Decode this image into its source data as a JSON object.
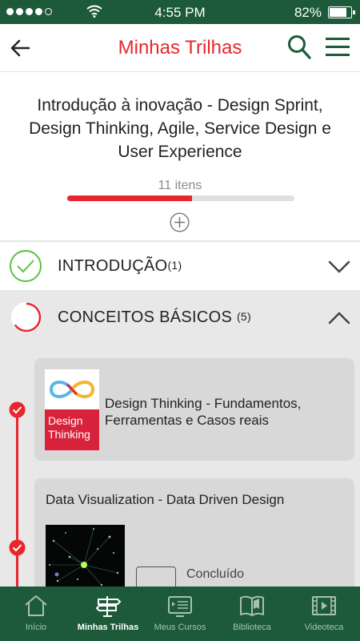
{
  "status_bar": {
    "time": "4:55 PM",
    "battery_percent": "82%",
    "battery_level": 0.82,
    "signal_dots_filled": 4,
    "signal_dots_total": 5
  },
  "app_bar": {
    "title": "Minhas Trilhas",
    "back_icon": "arrow-left-icon",
    "search_icon": "search-icon",
    "menu_icon": "hamburger-menu-icon"
  },
  "course": {
    "title": "Introdução à inovação - Design Sprint, Design Thinking, Agile, Service Design e User Experience",
    "items_count": "11 itens",
    "progress": 0.55,
    "expand_icon": "plus-circle-icon"
  },
  "modules": [
    {
      "name": "INTRODUÇÃO",
      "count": "(1)",
      "status": "completed",
      "expanded": false
    },
    {
      "name": "CONCEITOS BÁSICOS",
      "count": "(5)",
      "status": "in-progress",
      "expanded": true
    }
  ],
  "lessons": [
    {
      "title": "Design Thinking - Fundamentos, Ferramentas e Casos reais",
      "thumb_text": "Design Thinking"
    },
    {
      "title": "Data Visualization - Data Driven Design",
      "status_label": "Concluído"
    }
  ],
  "bottom_nav": [
    {
      "label": "Início",
      "icon": "home-icon",
      "active": false
    },
    {
      "label": "Minhas Trilhas",
      "icon": "signpost-icon",
      "active": true
    },
    {
      "label": "Meus Cursos",
      "icon": "video-list-icon",
      "active": false
    },
    {
      "label": "Biblioteca",
      "icon": "book-icon",
      "active": false
    },
    {
      "label": "Videoteca",
      "icon": "film-icon",
      "active": false
    }
  ],
  "colors": {
    "brand_green": "#1d5a3a",
    "accent_red": "#e8262e",
    "complete_green": "#5cc13f"
  }
}
